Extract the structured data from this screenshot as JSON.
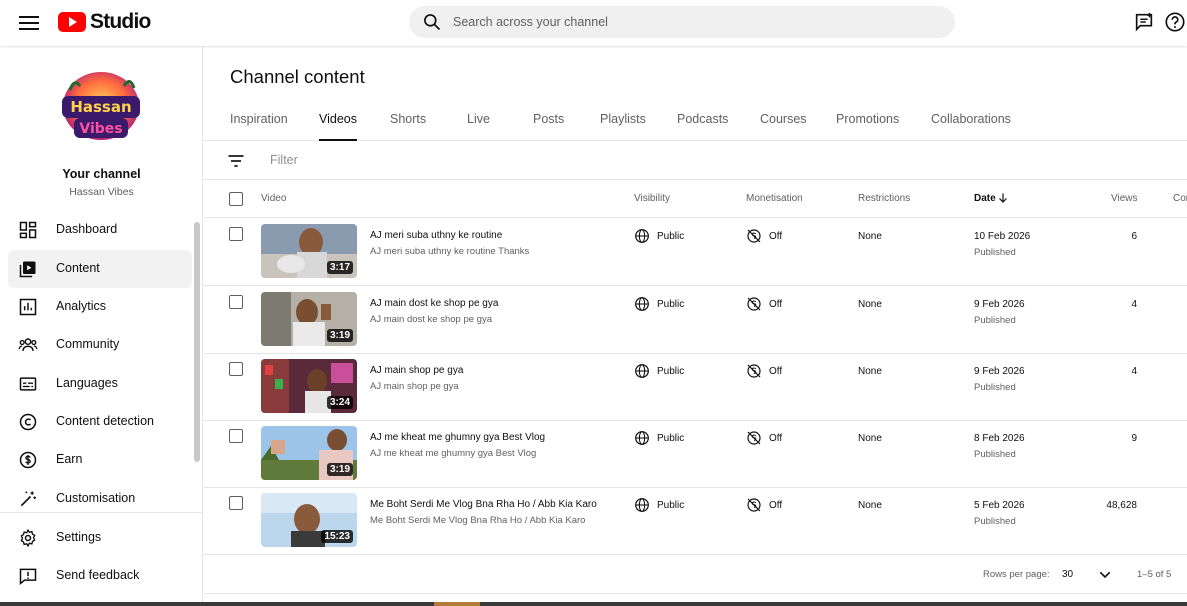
{
  "header": {
    "logo_text": "Studio",
    "search_placeholder": "Search across your channel"
  },
  "channel": {
    "avatar_text_line1": "Hassan",
    "avatar_text_line2": "Vibes",
    "your_channel_label": "Your channel",
    "name": "Hassan Vibes"
  },
  "sidebar": {
    "items": [
      {
        "label": "Dashboard",
        "icon": "dashboard-icon"
      },
      {
        "label": "Content",
        "icon": "content-icon",
        "active": true
      },
      {
        "label": "Analytics",
        "icon": "analytics-icon"
      },
      {
        "label": "Community",
        "icon": "community-icon"
      },
      {
        "label": "Languages",
        "icon": "languages-icon"
      },
      {
        "label": "Content detection",
        "icon": "copyright-icon"
      },
      {
        "label": "Earn",
        "icon": "dollar-icon"
      },
      {
        "label": "Customisation",
        "icon": "magic-wand-icon"
      }
    ],
    "bottom_items": [
      {
        "label": "Settings",
        "icon": "gear-icon"
      },
      {
        "label": "Send feedback",
        "icon": "feedback-icon"
      }
    ]
  },
  "main": {
    "title": "Channel content",
    "tabs": [
      "Inspiration",
      "Videos",
      "Shorts",
      "Live",
      "Posts",
      "Playlists",
      "Podcasts",
      "Courses",
      "Promotions",
      "Collaborations"
    ],
    "active_tab": "Videos",
    "filter_placeholder": "Filter"
  },
  "table": {
    "columns": {
      "video": "Video",
      "visibility": "Visibility",
      "monetisation": "Monetisation",
      "restrictions": "Restrictions",
      "date": "Date",
      "views": "Views",
      "comments": "Con"
    },
    "rows": [
      {
        "title": "AJ meri suba uthny ke routine",
        "desc": "AJ meri suba uthny ke routine Thanks",
        "duration": "3:17",
        "visibility": "Public",
        "monetisation": "Off",
        "restrictions": "None",
        "date": "10 Feb 2026",
        "status": "Published",
        "views": "6"
      },
      {
        "title": "AJ main dost ke shop pe gya",
        "desc": "AJ main dost ke shop pe gya",
        "duration": "3:19",
        "visibility": "Public",
        "monetisation": "Off",
        "restrictions": "None",
        "date": "9 Feb 2026",
        "status": "Published",
        "views": "4"
      },
      {
        "title": "AJ main shop pe gya",
        "desc": "AJ main shop pe gya",
        "duration": "3:24",
        "visibility": "Public",
        "monetisation": "Off",
        "restrictions": "None",
        "date": "9 Feb 2026",
        "status": "Published",
        "views": "4"
      },
      {
        "title": "AJ me kheat me ghumny gya Best Vlog",
        "desc": "AJ me kheat me ghumny gya Best Vlog",
        "duration": "3:19",
        "visibility": "Public",
        "monetisation": "Off",
        "restrictions": "None",
        "date": "8 Feb 2026",
        "status": "Published",
        "views": "9"
      },
      {
        "title": "Me Boht Serdi Me Vlog Bna Rha Ho / Abb Kia Karo",
        "desc": "Me Boht Serdi Me Vlog Bna Rha Ho / Abb Kia Karo",
        "duration": "15:23",
        "visibility": "Public",
        "monetisation": "Off",
        "restrictions": "None",
        "date": "5 Feb 2026",
        "status": "Published",
        "views": "48,628"
      }
    ]
  },
  "pagination": {
    "rows_per_page_label": "Rows per page:",
    "rows_per_page": "30",
    "range": "1–5 of 5"
  },
  "colors": {
    "brand_red": "#ff0000",
    "active_bg": "#f2f2f2",
    "text_secondary": "#606060"
  }
}
